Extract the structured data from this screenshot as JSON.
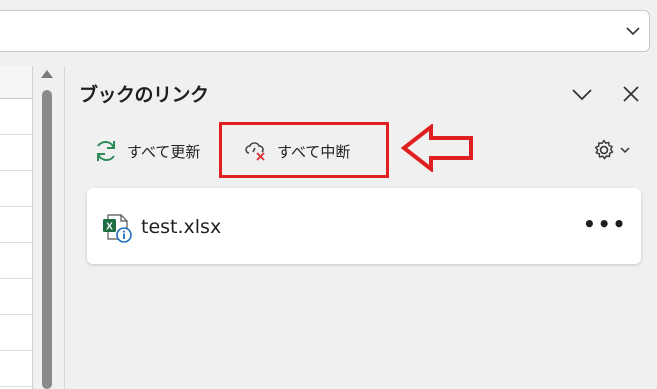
{
  "panel": {
    "title": "ブックのリンク"
  },
  "toolbar": {
    "refresh_all_label": "すべて更新",
    "break_all_label": "すべて中断"
  },
  "links": [
    {
      "file_name": "test.xlsx",
      "more_label": "•••"
    }
  ],
  "colors": {
    "highlight": "#e02020",
    "refresh_icon": "#2e8b57",
    "excel_green": "#1d6f42",
    "info_blue": "#1e6fb8"
  }
}
